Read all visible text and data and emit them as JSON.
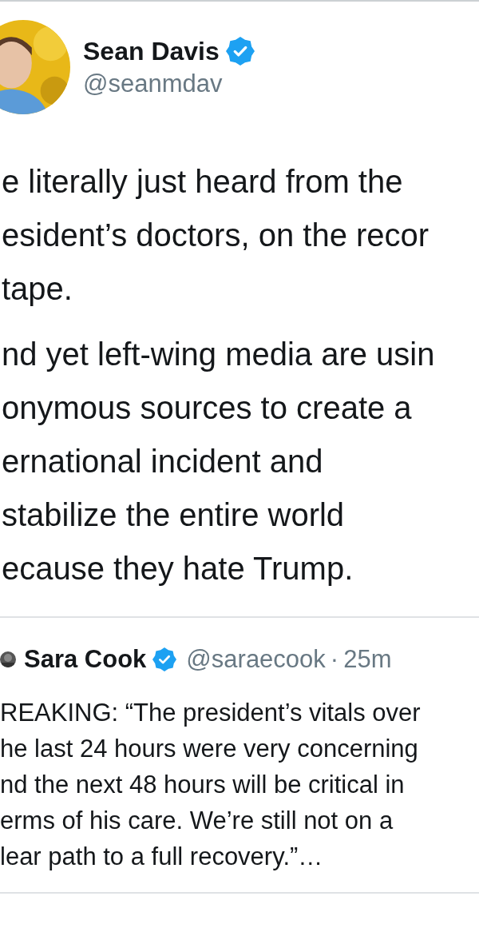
{
  "tweet": {
    "author": {
      "name": "Sean Davis",
      "verified": true,
      "handle": "@seanmdav"
    },
    "paragraphs": [
      {
        "lines": [
          "e literally just heard from the",
          "esident’s doctors, on the recor",
          "tape."
        ]
      },
      {
        "lines": [
          "nd yet left-wing media are usin",
          "onymous sources to create a",
          "ernational incident and",
          "stabilize the entire world",
          "ecause they hate Trump."
        ]
      }
    ],
    "quoted_tweet": {
      "author": {
        "name": "Sara Cook",
        "verified": true,
        "handle": "@saraecook"
      },
      "separator": "·",
      "time": "25m",
      "lines": [
        "REAKING: “The president’s vitals over",
        "he last 24 hours were very concerning",
        "nd the next 48 hours will be critical in",
        "erms of his care. We’re still not on a",
        "lear path to a full recovery.”…"
      ]
    }
  }
}
